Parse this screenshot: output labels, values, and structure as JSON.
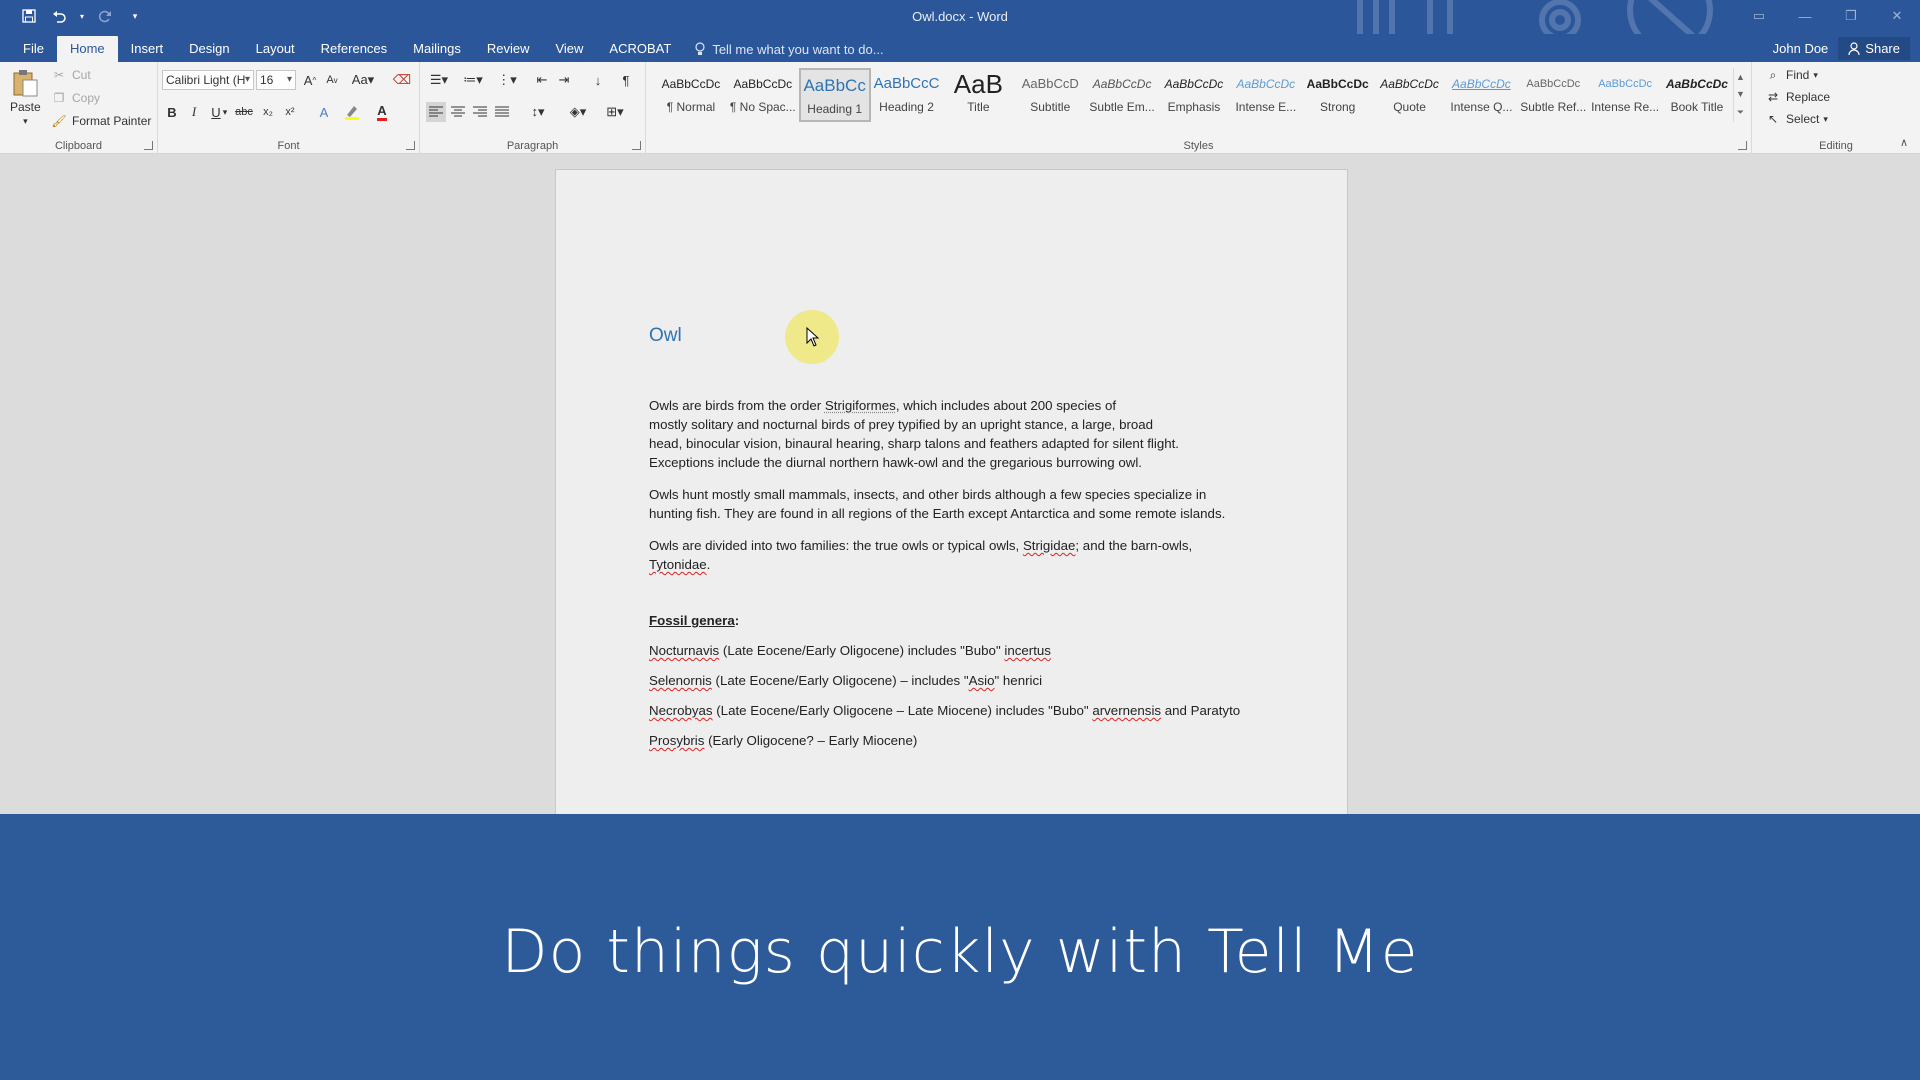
{
  "window": {
    "title": "Owl.docx - Word",
    "controls": [
      "restore-ribbon",
      "minimize",
      "maximize",
      "close"
    ]
  },
  "ribbon_tabs": [
    {
      "label": "File"
    },
    {
      "label": "Home"
    },
    {
      "label": "Insert"
    },
    {
      "label": "Design"
    },
    {
      "label": "Layout"
    },
    {
      "label": "References"
    },
    {
      "label": "Mailings"
    },
    {
      "label": "Review"
    },
    {
      "label": "View"
    },
    {
      "label": "ACROBAT"
    }
  ],
  "active_tab": "Home",
  "tell_me": {
    "placeholder": "Tell me what you want to do..."
  },
  "user": {
    "name": "John Doe",
    "share_label": "Share"
  },
  "clipboard": {
    "paste_label": "Paste",
    "cut_label": "Cut",
    "copy_label": "Copy",
    "format_painter_label": "Format Painter",
    "group_label": "Clipboard"
  },
  "font": {
    "family": "Calibri Light (H",
    "size": "16",
    "group_label": "Font"
  },
  "paragraph": {
    "group_label": "Paragraph"
  },
  "styles": {
    "group_label": "Styles",
    "items": [
      {
        "preview": "AaBbCcDc",
        "name": "¶ Normal"
      },
      {
        "preview": "AaBbCcDc",
        "name": "¶ No Spac..."
      },
      {
        "preview": "AaBbCc",
        "name": "Heading 1"
      },
      {
        "preview": "AaBbCcC",
        "name": "Heading 2"
      },
      {
        "preview": "AaB",
        "name": "Title"
      },
      {
        "preview": "AaBbCcD",
        "name": "Subtitle"
      },
      {
        "preview": "AaBbCcDc",
        "name": "Subtle Em..."
      },
      {
        "preview": "AaBbCcDc",
        "name": "Emphasis"
      },
      {
        "preview": "AaBbCcDc",
        "name": "Intense E..."
      },
      {
        "preview": "AaBbCcDc",
        "name": "Strong"
      },
      {
        "preview": "AaBbCcDc",
        "name": "Quote"
      },
      {
        "preview": "AaBbCcDc",
        "name": "Intense Q..."
      },
      {
        "preview": "AaBbCcDc",
        "name": "Subtle Ref..."
      },
      {
        "preview": "AaBbCcDc",
        "name": "Intense Re..."
      },
      {
        "preview": "AaBbCcDc",
        "name": "Book Title"
      }
    ],
    "selected": "Heading 1"
  },
  "editing": {
    "find_label": "Find",
    "replace_label": "Replace",
    "select_label": "Select",
    "group_label": "Editing"
  },
  "document": {
    "heading": "Owl",
    "p1_lines": [
      [
        "Owls are birds from the order ",
        "Strigiformes",
        ", which includes about 200 species of"
      ],
      [
        "mostly solitary and nocturnal birds of prey typified by an upright stance, a large, broad"
      ],
      [
        "head, binocular vision, binaural hearing, sharp talons and feathers adapted for silent flight."
      ],
      [
        "Exceptions include the diurnal northern hawk-owl and the gregarious burrowing owl."
      ]
    ],
    "p2_lines": [
      "Owls hunt mostly small mammals, insects, and other birds although a few species specialize in",
      "hunting fish. They are found in all regions of the Earth except Antarctica and some remote islands."
    ],
    "p3": {
      "before": "Owls are divided into two families: the true owls or typical owls, ",
      "strigidae": "Strigidae",
      "middle": "; and the barn-owls,",
      "tytonidae": "Tytonidae",
      "end": "."
    },
    "fossil_heading": "Fossil genera",
    "fossil_colon": ":",
    "fossils": [
      {
        "genus": "Nocturnavis",
        "text": " (Late Eocene/Early Oligocene) includes \"Bubo\" ",
        "species": "incertus",
        "tail": ""
      },
      {
        "genus": "Selenornis",
        "text": " (Late Eocene/Early Oligocene) – includes \"",
        "species": "Asio",
        "tail": "\" henrici"
      },
      {
        "genus": "Necrobyas",
        "text": " (Late Eocene/Early Oligocene – Late Miocene) includes \"Bubo\" ",
        "species": "arvernensis",
        "tail": " and Paratyto"
      },
      {
        "genus": "Prosybris",
        "text": " (Early Oligocene? – Early Miocene)",
        "species": "",
        "tail": ""
      }
    ]
  },
  "caption": "Do things quickly with Tell Me"
}
